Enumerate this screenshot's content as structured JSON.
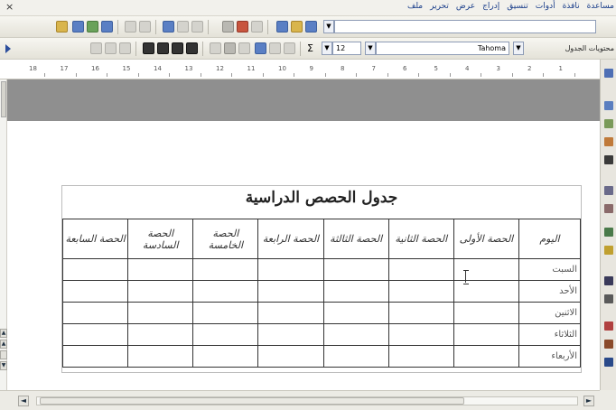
{
  "menu": {
    "items": [
      "ملف",
      "تحرير",
      "عرض",
      "إدراج",
      "تنسيق",
      "أدوات",
      "نافذة",
      "مساعدة"
    ]
  },
  "window": {
    "close_label": "×"
  },
  "formatting": {
    "style_name": "محتويات الجدول",
    "font_name": "Tahoma",
    "font_size": "12",
    "dropdown_glyph": "▼",
    "sum_glyph": "Σ"
  },
  "ruler": {
    "labels": [
      "18",
      "17",
      "16",
      "15",
      "14",
      "13",
      "12",
      "11",
      "10",
      "9",
      "8",
      "7",
      "6",
      "5",
      "4",
      "3",
      "2",
      "1"
    ]
  },
  "document": {
    "table_title": "جدول الحصص الدراسية",
    "header_day": "اليوم",
    "header_periods": [
      "الحصة الأولى",
      "الحصة الثانية",
      "الحصة الثالثة",
      "الحصة الرابعة",
      "الحصة الخامسة",
      "الحصة السادسة",
      "الحصة السابعة"
    ],
    "days": [
      "السبت",
      "الأحد",
      "الاثنين",
      "الثلاثاء",
      "الأربعاء"
    ]
  },
  "scroll": {
    "left_arrow": "◄",
    "right_arrow": "►",
    "up_arrow": "▲",
    "down_arrow": "▼"
  },
  "colors": {
    "menu_text": "#1a3e8a",
    "doc_gray": "#8f8f8f",
    "table_border": "#333333"
  }
}
